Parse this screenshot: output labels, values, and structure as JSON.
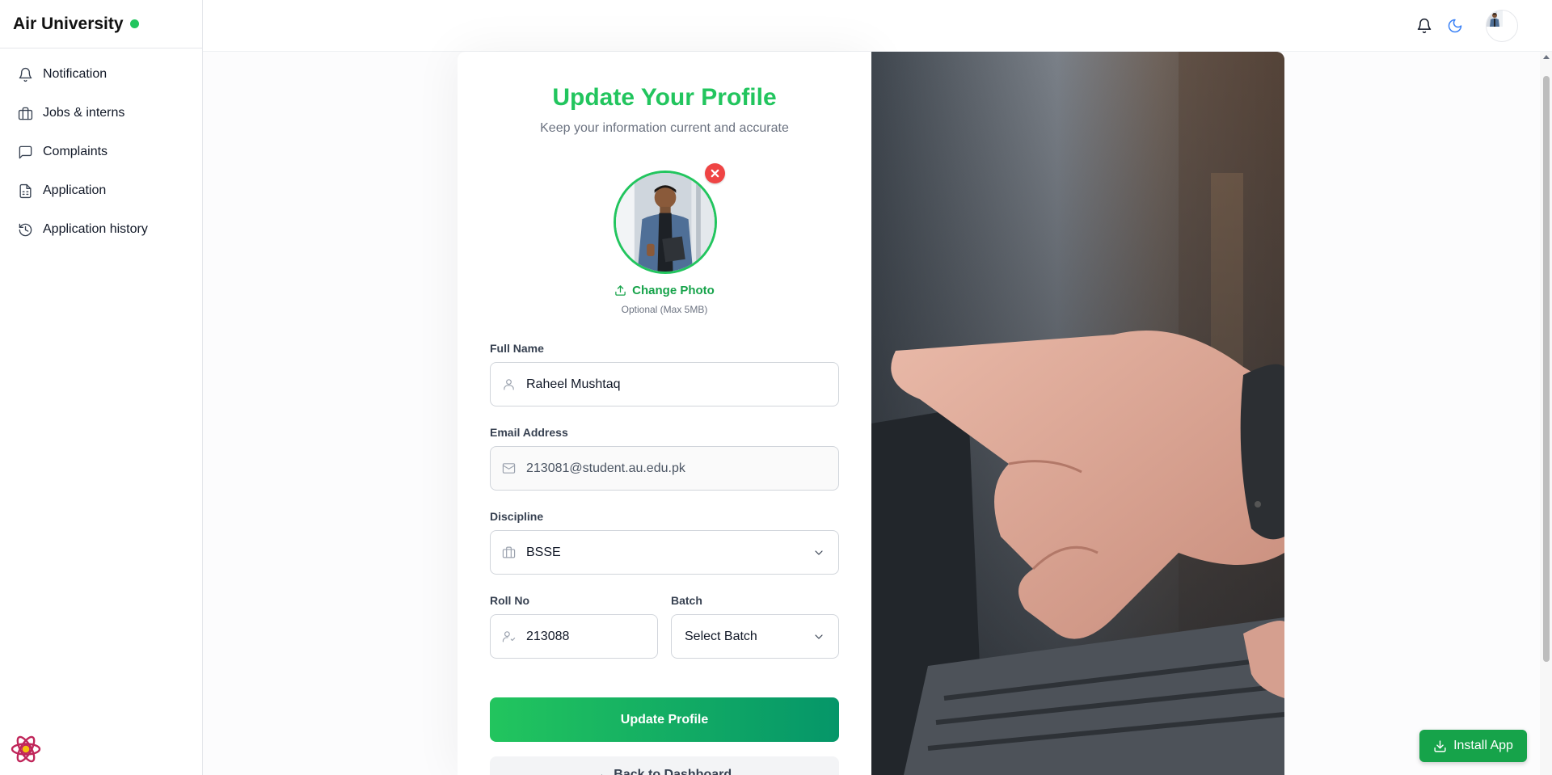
{
  "app": {
    "brand": "Air University",
    "status_color": "#22c55e"
  },
  "sidebar": {
    "items": [
      {
        "label": "Notification",
        "icon": "bell-icon"
      },
      {
        "label": "Jobs & interns",
        "icon": "briefcase-icon"
      },
      {
        "label": "Complaints",
        "icon": "message-square-icon"
      },
      {
        "label": "Application",
        "icon": "file-text-icon"
      },
      {
        "label": "Application history",
        "icon": "history-icon"
      }
    ]
  },
  "header": {
    "icons": [
      "bell-icon",
      "moon-icon",
      "avatar"
    ]
  },
  "form": {
    "title": "Update Your Profile",
    "subtitle": "Keep your information current and accurate",
    "change_photo": "Change Photo",
    "photo_hint": "Optional (Max 5MB)",
    "full_name": {
      "label": "Full Name",
      "value": "Raheel Mushtaq"
    },
    "email": {
      "label": "Email Address",
      "value": "213081@student.au.edu.pk"
    },
    "discipline": {
      "label": "Discipline",
      "value": "BSSE"
    },
    "roll_no": {
      "label": "Roll No",
      "value": "213088"
    },
    "batch": {
      "label": "Batch",
      "value": "Select Batch"
    },
    "submit": "Update Profile",
    "back": "← Back to Dashboard"
  },
  "install": {
    "label": "Install App"
  },
  "colors": {
    "accent": "#22c55e",
    "accent_dark": "#059669",
    "danger": "#ef4444"
  }
}
